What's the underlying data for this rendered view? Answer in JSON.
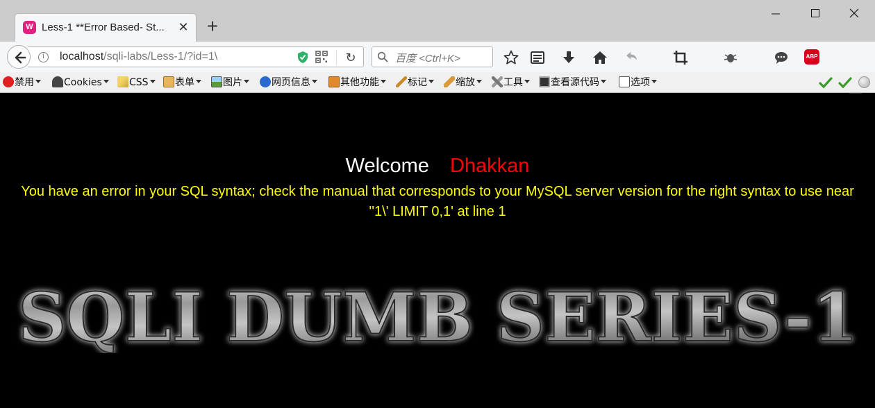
{
  "tab": {
    "title": "Less-1 **Error Based- St...",
    "favicon_icon": "wamp-favicon-icon"
  },
  "window_controls": {
    "minimize_icon": "minimize-icon",
    "maximize_icon": "maximize-icon",
    "close_icon": "close-icon"
  },
  "nav": {
    "url_host": "localhost",
    "url_path": "/sqli-labs/Less-1/?id=1\\",
    "search_placeholder": "百度 <Ctrl+K>"
  },
  "menubar": {
    "items": [
      {
        "label": "禁用",
        "icon": "disable-icon",
        "color": "#e02020"
      },
      {
        "label": "Cookies",
        "icon": "cookies-icon",
        "color": "#444444"
      },
      {
        "label": "CSS",
        "icon": "css-icon",
        "color": "#c9a33a"
      },
      {
        "label": "表单",
        "icon": "forms-icon",
        "color": "#c98a2a"
      },
      {
        "label": "图片",
        "icon": "images-icon",
        "color": "#5a9a3a"
      },
      {
        "label": "网页信息",
        "icon": "info-icon",
        "color": "#2a6ad0"
      },
      {
        "label": "其他功能",
        "icon": "misc-icon",
        "color": "#d07a1a"
      },
      {
        "label": "标记",
        "icon": "outline-icon",
        "color": "#c98a2a"
      },
      {
        "label": "缩放",
        "icon": "resize-icon",
        "color": "#c98a2a"
      },
      {
        "label": "工具",
        "icon": "tools-icon",
        "color": "#777777"
      },
      {
        "label": "查看源代码",
        "icon": "view-source-icon",
        "color": "#333333"
      },
      {
        "label": "选项",
        "icon": "options-icon",
        "color": "#555555"
      }
    ]
  },
  "page": {
    "welcome": "Welcome",
    "username": "Dhakkan",
    "error_message": "You have an error in your SQL syntax; check the manual that corresponds to your MySQL server version for the right syntax to use near ''1\\' LIMIT 0,1' at line 1",
    "banner_text": "SQLI DUMB SERIES-1",
    "colors": {
      "welcome": "#ffffff",
      "username": "#ff0000",
      "error": "#ffff00",
      "background": "#000000"
    }
  }
}
